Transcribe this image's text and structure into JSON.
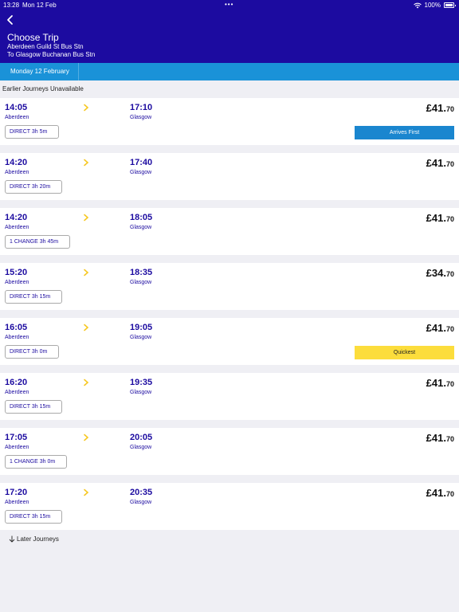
{
  "status_bar": {
    "time": "13:28",
    "date": "Mon 12 Feb",
    "dots": "•••",
    "battery": "100%"
  },
  "header": {
    "title": "Choose Trip",
    "from": "Aberdeen Guild St Bus Stn",
    "to": "To Glasgow Buchanan Bus Stn"
  },
  "date_tab": "Monday 12 February",
  "earlier_label": "Earlier Journeys Unavailable",
  "later_label": "Later Journeys",
  "colors": {
    "brand_navy": "#1c0ba0",
    "date_bar_blue": "#1a92d8",
    "arrow_yellow": "#f6c823",
    "tag_blue": "#1a86cf",
    "tag_yellow": "#fcdd3c"
  },
  "journeys": [
    {
      "dep_time": "14:05",
      "dep_place": "Aberdeen",
      "arr_time": "17:10",
      "arr_place": "Glasgow",
      "price_main": "£41.",
      "price_pence": "70",
      "duration": "DIRECT 3h 5m",
      "tag": "Arrives First"
    },
    {
      "dep_time": "14:20",
      "dep_place": "Aberdeen",
      "arr_time": "17:40",
      "arr_place": "Glasgow",
      "price_main": "£41.",
      "price_pence": "70",
      "duration": "DIRECT 3h 20m"
    },
    {
      "dep_time": "14:20",
      "dep_place": "Aberdeen",
      "arr_time": "18:05",
      "arr_place": "Glasgow",
      "price_main": "£41.",
      "price_pence": "70",
      "duration": "1 CHANGE 3h 45m"
    },
    {
      "dep_time": "15:20",
      "dep_place": "Aberdeen",
      "arr_time": "18:35",
      "arr_place": "Glasgow",
      "price_main": "£34.",
      "price_pence": "70",
      "duration": "DIRECT 3h 15m"
    },
    {
      "dep_time": "16:05",
      "dep_place": "Aberdeen",
      "arr_time": "19:05",
      "arr_place": "Glasgow",
      "price_main": "£41.",
      "price_pence": "70",
      "duration": "DIRECT 3h 0m",
      "tag": "Quickest"
    },
    {
      "dep_time": "16:20",
      "dep_place": "Aberdeen",
      "arr_time": "19:35",
      "arr_place": "Glasgow",
      "price_main": "£41.",
      "price_pence": "70",
      "duration": "DIRECT 3h 15m"
    },
    {
      "dep_time": "17:05",
      "dep_place": "Aberdeen",
      "arr_time": "20:05",
      "arr_place": "Glasgow",
      "price_main": "£41.",
      "price_pence": "70",
      "duration": "1 CHANGE 3h 0m"
    },
    {
      "dep_time": "17:20",
      "dep_place": "Aberdeen",
      "arr_time": "20:35",
      "arr_place": "Glasgow",
      "price_main": "£41.",
      "price_pence": "70",
      "duration": "DIRECT 3h 15m"
    }
  ]
}
